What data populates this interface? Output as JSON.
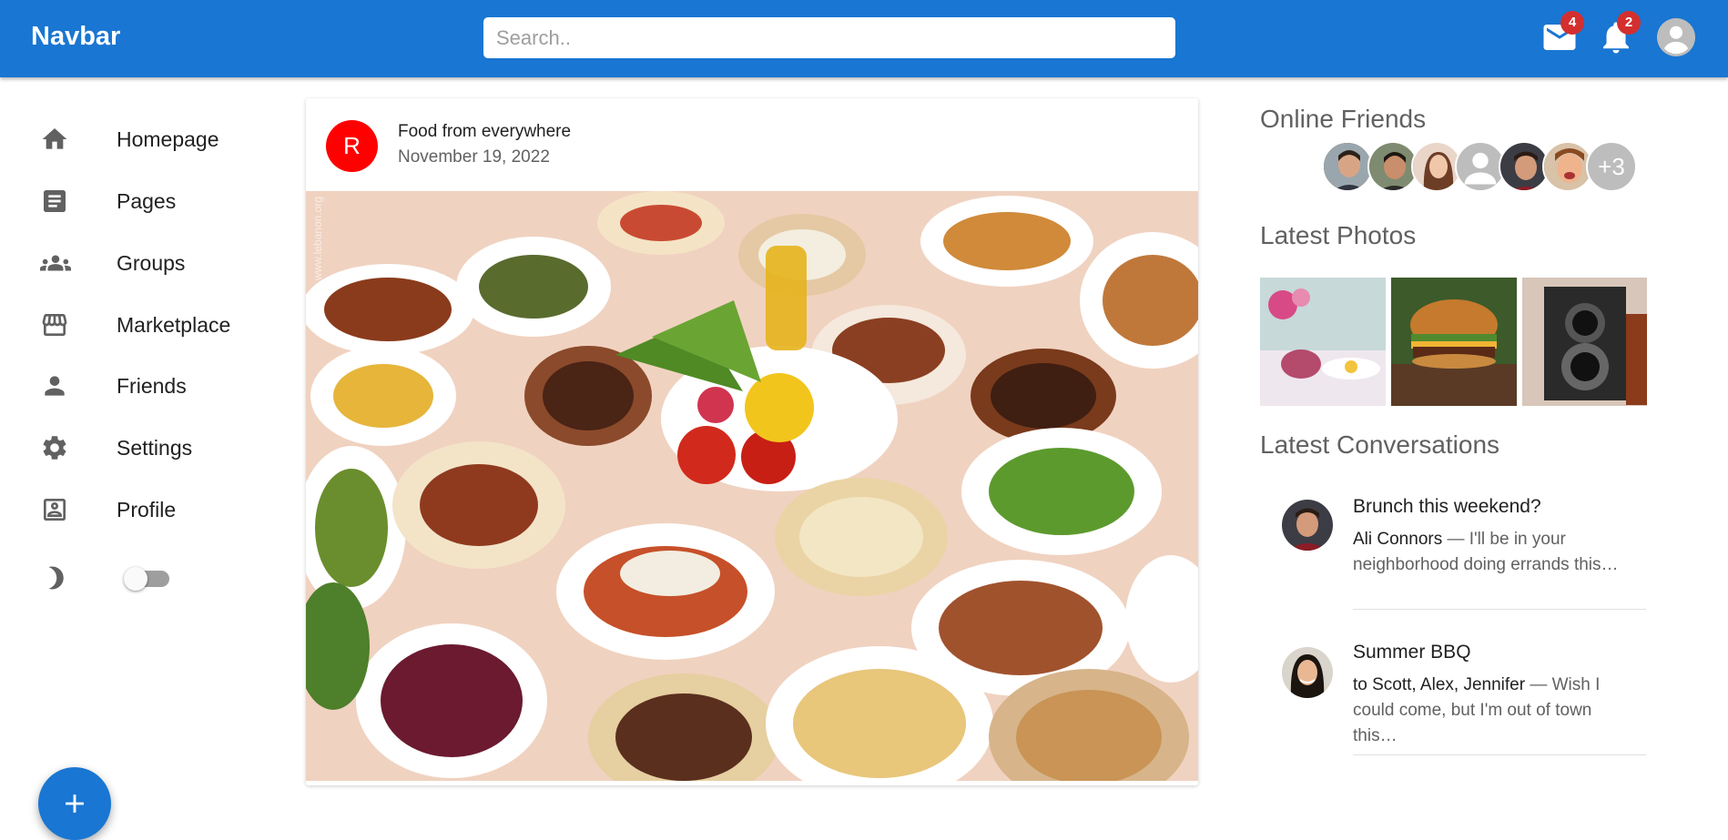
{
  "navbar": {
    "logo": "Navbar",
    "search_placeholder": "Search..",
    "mail_badge": "4",
    "notifications_badge": "2"
  },
  "sidebar": {
    "items": [
      {
        "label": "Homepage",
        "icon": "home-icon"
      },
      {
        "label": "Pages",
        "icon": "article-icon"
      },
      {
        "label": "Groups",
        "icon": "groups-icon"
      },
      {
        "label": "Marketplace",
        "icon": "storefront-icon"
      },
      {
        "label": "Friends",
        "icon": "person-icon"
      },
      {
        "label": "Settings",
        "icon": "settings-icon"
      },
      {
        "label": "Profile",
        "icon": "account-box-icon"
      }
    ],
    "dark_mode_on": false
  },
  "post": {
    "avatar_letter": "R",
    "title": "Food from everywhere",
    "date": "November 19, 2022",
    "watermark": "www.lebanon.org"
  },
  "rightbar": {
    "online_title": "Online Friends",
    "online_more": "+3",
    "photos_title": "Latest Photos",
    "conversations_title": "Latest Conversations",
    "conversations": [
      {
        "title": "Brunch this weekend?",
        "sender": "Ali Connors",
        "text": " — I'll be in your neighborhood doing errands this…"
      },
      {
        "title": "Summer BBQ",
        "sender": "to Scott, Alex, Jennifer",
        "text": " — Wish I could come, but I'm out of town this…"
      }
    ]
  },
  "colors": {
    "primary": "#1976d2",
    "badge": "#d32f2f",
    "post_avatar": "#ff0000"
  }
}
